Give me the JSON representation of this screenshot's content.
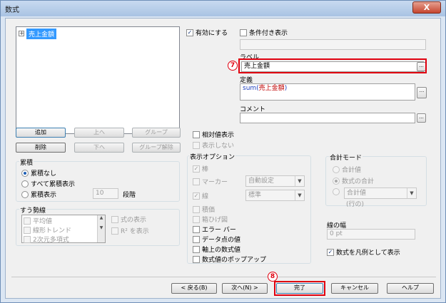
{
  "window": {
    "title": "数式",
    "close_label": "X"
  },
  "tree": {
    "items": [
      {
        "label": "売上金額",
        "expander": "+"
      }
    ]
  },
  "list_buttons": {
    "add": "追加",
    "up": "上へ",
    "group": "グループ",
    "delete": "削除",
    "down": "下へ",
    "ungroup": "グループ解除"
  },
  "cumulative": {
    "title": "累積",
    "options": [
      {
        "label": "累積なし",
        "selected": true
      },
      {
        "label": "すべて累積表示",
        "selected": false
      },
      {
        "label": "累積表示",
        "selected": false
      }
    ],
    "steps_value": "10",
    "steps_label": "段階"
  },
  "trendline": {
    "title": "すう勢線",
    "items": [
      "平均値",
      "線形トレンド",
      "2次元多項式"
    ],
    "show_formula": "式の表示",
    "show_r2": "R² を表示"
  },
  "enable_checkbox": {
    "label": "有効にする",
    "checked": true
  },
  "conditional_checkbox": {
    "label": "条件付き表示",
    "checked": false
  },
  "conditional_value": "",
  "label_section": {
    "title": "ラベル",
    "value": "売上金額",
    "callout": "7"
  },
  "definition": {
    "title": "定義",
    "func": "sum(",
    "arg": "売上金額",
    "close": ")",
    "func_color": "#1f3fbf",
    "arg_color": "#c00000"
  },
  "comment": {
    "title": "コメント",
    "value": ""
  },
  "relative": {
    "label": "相対値表示",
    "checked": false
  },
  "hidden": {
    "label": "表示しない",
    "checked": false
  },
  "display_options": {
    "title": "表示オプション",
    "bar": "棒",
    "marker": "マーカー",
    "marker_value": "自動設定",
    "line": "線",
    "line_value": "標準",
    "stack": "積価",
    "box": "箱ひげ図",
    "error_bar": "エラー バー",
    "data_point": "データ点の値",
    "axis_value": "軸上の数式値",
    "popup": "数式値のポップアップ"
  },
  "total_mode": {
    "title": "合計モード",
    "options": [
      {
        "label": "合計値",
        "selected": false
      },
      {
        "label": "数式の合計",
        "selected": true
      }
    ],
    "row_combo": "合計値",
    "row_label": "(行の)"
  },
  "line_width": {
    "title": "線の幅",
    "value": "0 pt"
  },
  "legend_check": {
    "label": "数式を凡例として表示",
    "checked": true
  },
  "footer": {
    "back": "< 戻る(B)",
    "next": "次へ(N) >",
    "finish": "完了",
    "cancel": "キャンセル",
    "help": "ヘルプ",
    "callout": "8"
  },
  "colors": {
    "highlight": "#e0000f",
    "selection": "#3399ff"
  }
}
